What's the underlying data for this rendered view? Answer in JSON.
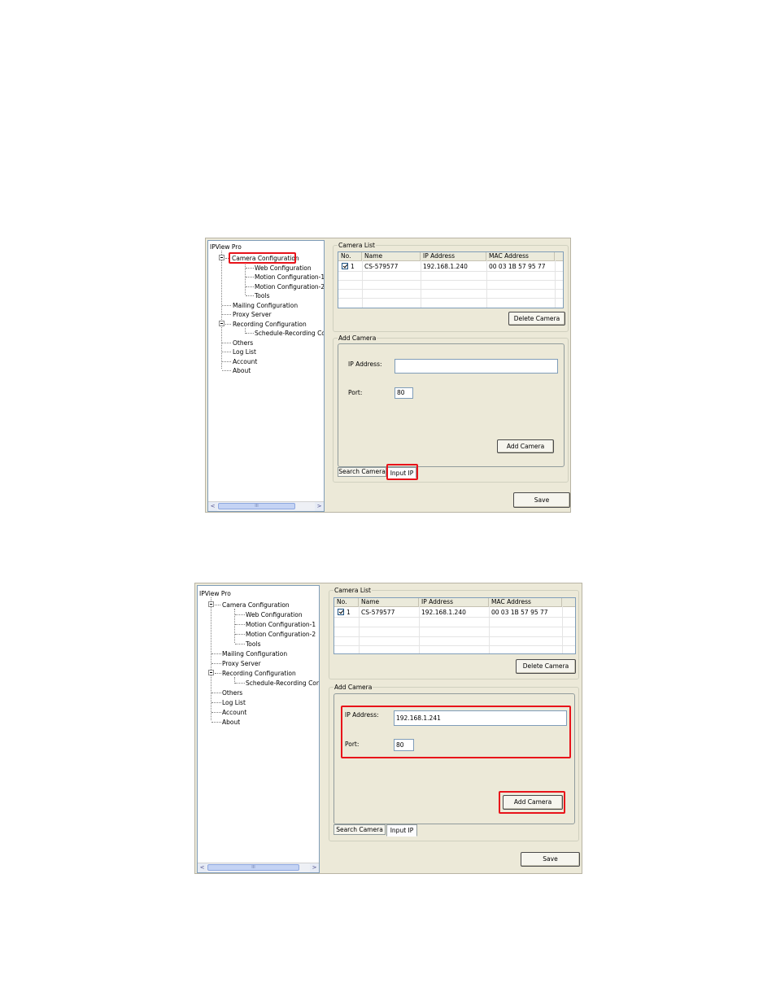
{
  "screens": [
    {
      "tree": {
        "root": "IPView Pro",
        "items": [
          {
            "label": "Camera Configuration"
          },
          {
            "label": "Web Configuration"
          },
          {
            "label": "Motion Configuration-1"
          },
          {
            "label": "Motion Configuration-2"
          },
          {
            "label": "Tools"
          },
          {
            "label": "Mailing Configuration"
          },
          {
            "label": "Proxy Server"
          },
          {
            "label": "Recording Configuration"
          },
          {
            "label": "Schedule-Recording Con"
          },
          {
            "label": "Others"
          },
          {
            "label": "Log List"
          },
          {
            "label": "Account"
          },
          {
            "label": "About"
          }
        ],
        "scroll_left": "<",
        "scroll_right": ">",
        "scroll_grip": "III"
      },
      "camera_list": {
        "legend": "Camera List",
        "columns": [
          "No.",
          "Name",
          "IP Address",
          "MAC Address"
        ],
        "rows": [
          {
            "no": "1",
            "name": "CS-579577",
            "ip": "192.168.1.240",
            "mac": "00 03 1B 57 95 77",
            "checked": true
          }
        ],
        "delete_button": "Delete Camera"
      },
      "add_camera": {
        "legend": "Add Camera",
        "ip_label": "IP Address:",
        "ip_value": "",
        "port_label": "Port:",
        "port_value": "80",
        "add_button": "Add Camera"
      },
      "tabs": [
        "Search Camera",
        "Input IP"
      ],
      "save_button": "Save"
    },
    {
      "tree": {
        "root": "IPView Pro",
        "items": [
          {
            "label": "Camera Configuration"
          },
          {
            "label": "Web Configuration"
          },
          {
            "label": "Motion Configuration-1"
          },
          {
            "label": "Motion Configuration-2"
          },
          {
            "label": "Tools"
          },
          {
            "label": "Mailing Configuration"
          },
          {
            "label": "Proxy Server"
          },
          {
            "label": "Recording Configuration"
          },
          {
            "label": "Schedule-Recording Con"
          },
          {
            "label": "Others"
          },
          {
            "label": "Log List"
          },
          {
            "label": "Account"
          },
          {
            "label": "About"
          }
        ],
        "scroll_left": "<",
        "scroll_right": ">",
        "scroll_grip": "III"
      },
      "camera_list": {
        "legend": "Camera List",
        "columns": [
          "No.",
          "Name",
          "IP Address",
          "MAC Address"
        ],
        "rows": [
          {
            "no": "1",
            "name": "CS-579577",
            "ip": "192.168.1.240",
            "mac": "00 03 1B 57 95 77",
            "checked": true
          }
        ],
        "delete_button": "Delete Camera"
      },
      "add_camera": {
        "legend": "Add Camera",
        "ip_label": "IP Address:",
        "ip_value": "192.168.1.241",
        "port_label": "Port:",
        "port_value": "80",
        "add_button": "Add Camera"
      },
      "tabs": [
        "Search Camera",
        "Input IP"
      ],
      "save_button": "Save"
    }
  ],
  "colors": {
    "highlight": "#e8131a",
    "panel": "#ece9d8",
    "border": "#7f9db9"
  }
}
